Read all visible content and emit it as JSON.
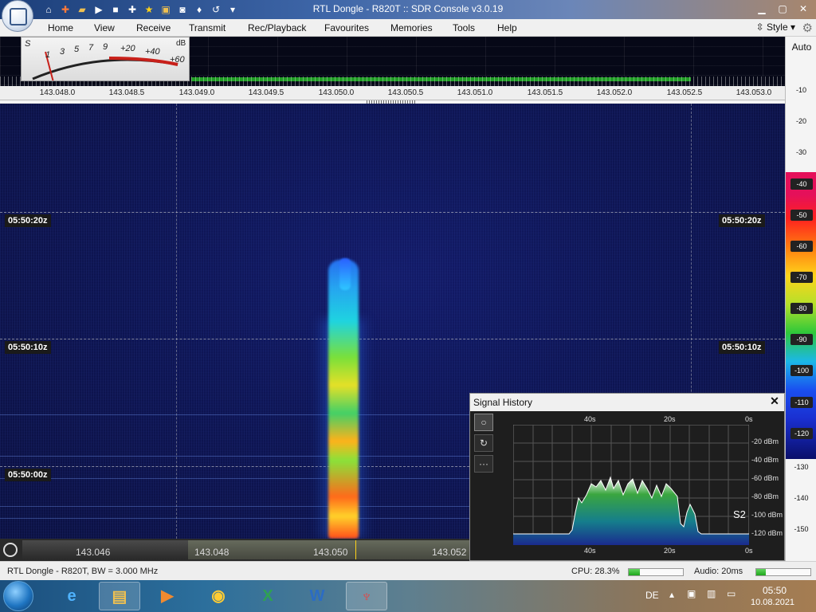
{
  "titlebar": {
    "title": "RTL Dongle - R820T :: SDR Console v3.0.19",
    "quick_access_icons": [
      "home-icon",
      "lifebuoy-icon",
      "folder-icon",
      "play-icon",
      "stop-icon",
      "add-icon",
      "star-icon",
      "lock-icon",
      "camera-icon",
      "drop-icon",
      "undo-icon",
      "dropdown-arrow-icon"
    ],
    "controls": [
      "minimize-icon",
      "maximize-icon",
      "close-icon"
    ]
  },
  "menu": {
    "items": [
      "Home",
      "View",
      "Receive",
      "Transmit",
      "Rec/Playback",
      "Favourites",
      "Memories",
      "Tools",
      "Help"
    ],
    "style_label": "Style"
  },
  "smeter": {
    "s_label": "S",
    "db_label": "dB",
    "s_marks": [
      "1",
      "3",
      "5",
      "7",
      "9"
    ],
    "plus_marks": [
      "+20",
      "+40",
      "+60"
    ]
  },
  "freq_axis": {
    "labels": [
      "143.048.0",
      "143.048.5",
      "143.049.0",
      "143.049.5",
      "143.050.0",
      "143.050.5",
      "143.051.0",
      "143.051.5",
      "143.052.0",
      "143.052.5",
      "143.053.0"
    ]
  },
  "waterfall": {
    "timestamps": [
      "05:50:20z",
      "05:50:10z",
      "05:50:00z"
    ]
  },
  "bottom_bar": {
    "labels": [
      "143.046",
      "143.048",
      "143.050",
      "143.052"
    ]
  },
  "scale": {
    "auto_label": "Auto",
    "ticks": [
      "-10",
      "-20",
      "-30",
      "-40",
      "-50",
      "-60",
      "-70",
      "-80",
      "-90",
      "-100",
      "-110",
      "-120",
      "-130",
      "-140",
      "-150"
    ]
  },
  "signal_history": {
    "title": "Signal History",
    "top_labels": [
      "40s",
      "20s",
      "0s"
    ],
    "bottom_labels": [
      "40s",
      "20s",
      "0s"
    ],
    "y_labels": [
      "-20 dBm",
      "-40 dBm",
      "-60 dBm",
      "-80 dBm",
      "-100 dBm",
      "-120 dBm"
    ],
    "s_reading": "S2",
    "tools": [
      "circle-icon",
      "refresh-icon",
      "more-icon"
    ]
  },
  "statusbar": {
    "device": "RTL Dongle - R820T, BW = 3.000 MHz",
    "cpu": "CPU: 28.3%",
    "cpu_level": 0.2,
    "audio": "Audio: 20ms",
    "audio_level": 0.18
  },
  "taskbar": {
    "language": "DE",
    "time": "05:50",
    "date": "10.08.2021",
    "apps": [
      "ie-icon",
      "explorer-icon",
      "media-player-icon",
      "chrome-icon",
      "excel-icon",
      "word-icon",
      "sdr-console-icon"
    ]
  },
  "colors": {
    "signal_yellow": "#ffd21a",
    "waterfall_bg": "#0b0f3a",
    "scale_top": "#e5105a"
  }
}
